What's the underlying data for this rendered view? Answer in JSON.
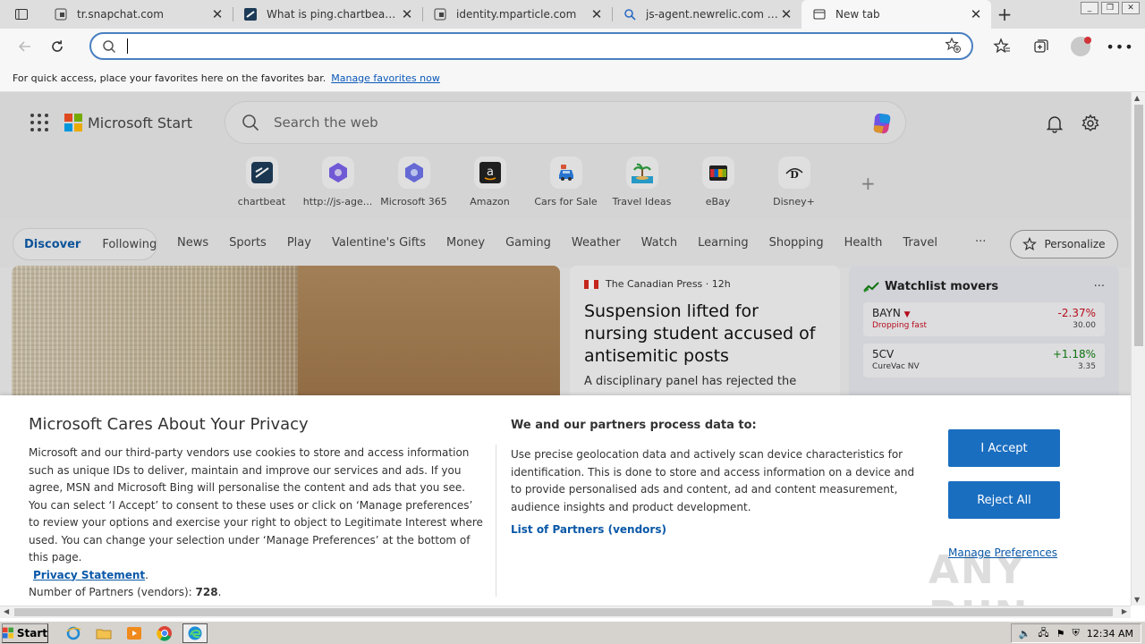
{
  "browser": {
    "tabs": [
      {
        "title": "tr.snapchat.com",
        "icon": "globe-lock-icon",
        "active": false
      },
      {
        "title": "What is ping.chartbeat.net?",
        "icon": "chartbeat-icon",
        "active": false
      },
      {
        "title": "identity.mparticle.com",
        "icon": "globe-lock-icon",
        "active": false
      },
      {
        "title": "js-agent.newrelic.com what",
        "icon": "search-icon",
        "active": false
      },
      {
        "title": "New tab",
        "icon": "newtab-icon",
        "active": true
      }
    ],
    "address": {
      "value": "",
      "placeholder": ""
    },
    "favorites_bar": {
      "message": "For quick access, place your favorites here on the favorites bar.",
      "link": "Manage favorites now"
    }
  },
  "msn": {
    "brand": "Microsoft Start",
    "search_placeholder": "Search the web",
    "quick_links": [
      {
        "label": "chartbeat",
        "icon": "chartbeat-icon"
      },
      {
        "label": "http://js-age...",
        "icon": "copilot-hex-icon"
      },
      {
        "label": "Microsoft 365",
        "icon": "microsoft365-icon"
      },
      {
        "label": "Amazon",
        "icon": "amazon-icon"
      },
      {
        "label": "Cars for Sale",
        "icon": "car-icon"
      },
      {
        "label": "Travel Ideas",
        "icon": "palm-tree-icon"
      },
      {
        "label": "eBay",
        "icon": "ebay-icon"
      },
      {
        "label": "Disney+",
        "icon": "disney-icon"
      }
    ],
    "nav": {
      "discover": "Discover",
      "following": "Following",
      "links": [
        "News",
        "Sports",
        "Play",
        "Valentine's Gifts",
        "Money",
        "Gaming",
        "Weather",
        "Watch",
        "Learning",
        "Shopping",
        "Health",
        "Travel"
      ],
      "more": "···",
      "personalize": "Personalize"
    },
    "news": {
      "source": "The Canadian Press",
      "age": "12h",
      "headline": "Suspension lifted for nursing student accused of antisemitic posts",
      "snippet": "A disciplinary panel has rejected the"
    },
    "watchlist": {
      "title": "Watchlist movers",
      "more": "···",
      "stocks": [
        {
          "symbol": "BAYN",
          "sub": "Dropping fast",
          "change": "-2.37%",
          "price": "30.00",
          "direction": "down"
        },
        {
          "symbol": "5CV",
          "sub": "CureVac NV",
          "change": "+1.18%",
          "price": "3.35",
          "direction": "up"
        }
      ]
    }
  },
  "privacy": {
    "title": "Microsoft Cares About Your Privacy",
    "body": "Microsoft and our third-party vendors use cookies to store and access information such as unique IDs to deliver, maintain and improve our services and ads. If you agree, MSN and Microsoft Bing will personalise the content and ads that you see. You can select ‘I Accept’ to consent to these uses or click on ‘Manage preferences’ to review your options and exercise your right to object to Legitimate Interest where used.  You can change your selection under ‘Manage Preferences’ at the bottom of this page.",
    "privacy_link": "Privacy Statement",
    "partners_count_label": "Number of Partners (vendors):",
    "partners_count": "728",
    "process_title": "We and our partners process data to:",
    "process_body": "Use precise geolocation data and actively scan device characteristics for identification. This is done to store and access information on a device and to provide personalised ads and content, ad and content measurement, audience insights and product development.",
    "partners_link": "List of Partners (vendors)",
    "accept": "I Accept",
    "reject": "Reject All",
    "manage": "Manage Preferences"
  },
  "watermark": "ANY RUN",
  "taskbar": {
    "start": "Start",
    "clock": "12:34 AM"
  },
  "colors": {
    "accent": "#1a6ec0",
    "link": "#0a58a8",
    "negative": "#c50f1f",
    "positive": "#107c10"
  }
}
